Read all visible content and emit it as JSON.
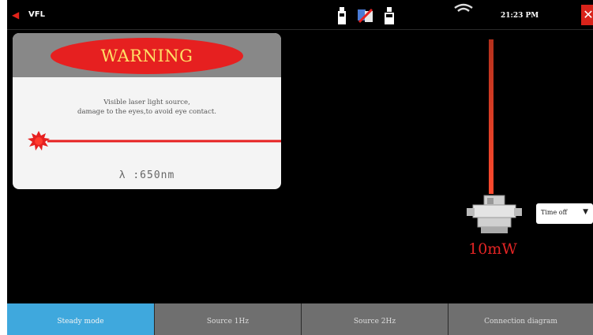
{
  "status_bar": {
    "app_title": "VFL",
    "time": "21:23 PM",
    "close_label": "✕"
  },
  "warning": {
    "title": "WARNING",
    "message_line1": "Visible laser light source,",
    "message_line2": "damage to the eyes,to avoid eye contact.",
    "wavelength": "λ :650nm"
  },
  "laser": {
    "power": "10mW",
    "timer_selected": "Time off"
  },
  "tabs": [
    {
      "label": "Steady mode",
      "active": true
    },
    {
      "label": "Source 1Hz",
      "active": false
    },
    {
      "label": "Source 2Hz",
      "active": false
    },
    {
      "label": "Connection diagram",
      "active": false
    }
  ],
  "colors": {
    "laser_red": "#e62020",
    "active_tab": "#3fa8dd",
    "inactive_tab": "#6f6f6f"
  }
}
